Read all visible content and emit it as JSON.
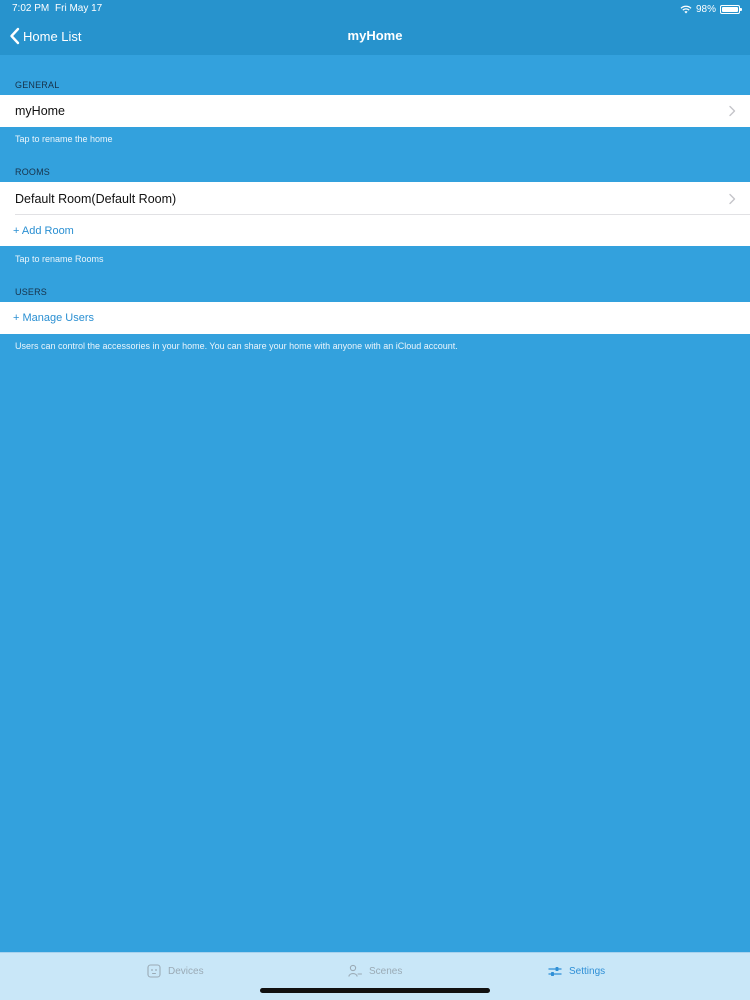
{
  "status_bar": {
    "time": "7:02 PM",
    "date": "Fri May 17",
    "battery": "98%",
    "battery_level": 0.98,
    "wifi_icon": "wifi-icon",
    "battery_icon": "battery-icon"
  },
  "nav": {
    "back_label": "Home List",
    "back_icon": "chevron-left-icon",
    "title": "myHome"
  },
  "sections": {
    "general": {
      "header": "GENERAL",
      "row_label": "myHome",
      "footer": "Tap to rename the home"
    },
    "rooms": {
      "header": "ROOMS",
      "room_label": "Default Room(Default Room)",
      "add_label": "+ Add Room",
      "footer": "Tap to rename Rooms"
    },
    "users": {
      "header": "USERS",
      "manage_label": "+ Manage Users",
      "footer": "Users can control the accessories in your home. You can share your home with anyone with an iCloud account."
    }
  },
  "tabs": [
    {
      "label": "Devices",
      "icon": "devices-icon",
      "active": false
    },
    {
      "label": "Scenes",
      "icon": "scenes-icon",
      "active": false
    },
    {
      "label": "Settings",
      "icon": "settings-icon",
      "active": true
    }
  ],
  "colors": {
    "background": "#33a1dd",
    "nav_background": "#2793cd",
    "tab_bar_background": "#c9e7f8",
    "accent": "#2f8fd6",
    "tab_inactive": "#9aaab5"
  }
}
